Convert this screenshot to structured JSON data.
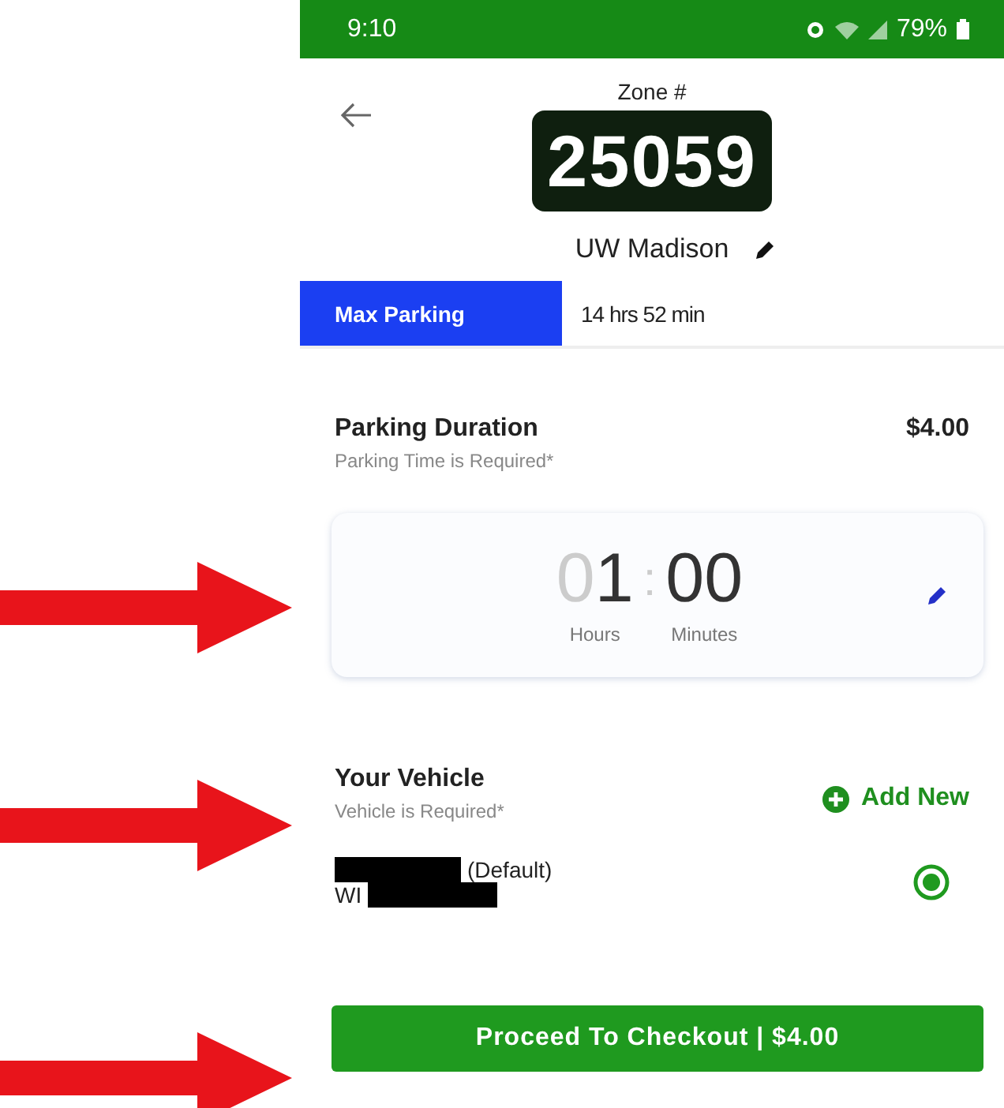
{
  "status_bar": {
    "time": "9:10",
    "battery": "79%"
  },
  "header": {
    "zone_label": "Zone #",
    "zone_number": "25059",
    "location": "UW Madison"
  },
  "tabs": [
    {
      "label": "Max Parking",
      "selected": true
    },
    {
      "label": "14 hrs 52 min",
      "selected": false
    }
  ],
  "duration": {
    "title": "Parking Duration",
    "subtitle": "Parking Time is Required*",
    "price": "$4.00",
    "hours_lead": "0",
    "hours": "1",
    "separator": ":",
    "minutes": "00",
    "hours_label": "Hours",
    "minutes_label": "Minutes"
  },
  "vehicle": {
    "title": "Your Vehicle",
    "subtitle": "Vehicle is Required*",
    "add_label": "Add New",
    "items": [
      {
        "name": "(Default)",
        "plate": "WI",
        "redacted": true,
        "selected": true
      }
    ]
  },
  "checkout": {
    "label": "Proceed To Checkout | $4.00"
  },
  "annotations": [
    {
      "kind": "arrow"
    },
    {
      "kind": "arrow"
    },
    {
      "kind": "arrow"
    }
  ]
}
